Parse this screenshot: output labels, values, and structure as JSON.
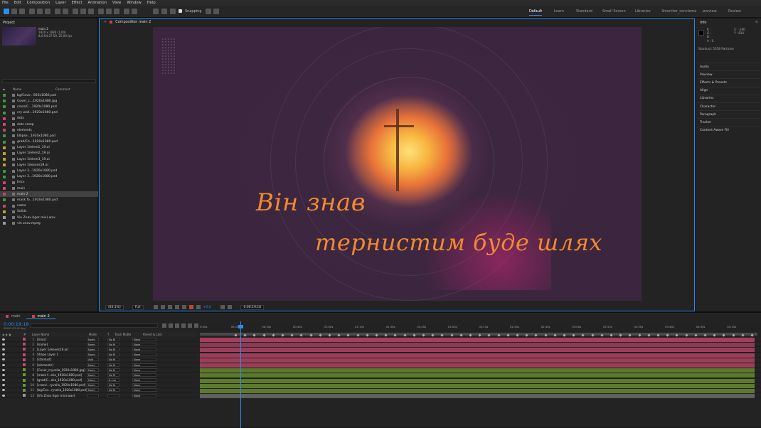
{
  "menu": [
    "File",
    "Edit",
    "Composition",
    "Layer",
    "Effect",
    "Animation",
    "View",
    "Window",
    "Help"
  ],
  "toolbar": {
    "snapping_label": "Snapping"
  },
  "workspaces": [
    {
      "label": "Default",
      "active": true
    },
    {
      "label": "Learn",
      "active": false
    },
    {
      "label": "Standard",
      "active": false
    },
    {
      "label": "Small Screen",
      "active": false
    },
    {
      "label": "Libraries",
      "active": false
    },
    {
      "label": "3monitor_osnclema",
      "active": false
    },
    {
      "label": "preview",
      "active": false
    },
    {
      "label": "Review",
      "active": false
    }
  ],
  "project": {
    "tab": "Project",
    "comp_name": "main 2",
    "comp_res": "1920 x 1080 (1,00)",
    "comp_dur": "Δ 0:04:27:59, 25,00 fps",
    "col_name": "Name",
    "col_comment": "Comment",
    "items": [
      {
        "name": "bg/Cove...920x1080.psd",
        "color": "#3a9a3a",
        "selected": false
      },
      {
        "name": "Cover_c...1920x1080.jpg",
        "color": "#3a9a3a",
        "selected": false
      },
      {
        "name": "cross/C...1920x1080.psd",
        "color": "#3a9a3a",
        "selected": false
      },
      {
        "name": "cry wall...1920x1080.psd",
        "color": "#3a9a3a",
        "selected": false
      },
      {
        "name": "dots",
        "color": "#c04a6a",
        "selected": false
      },
      {
        "name": "dots comp",
        "color": "#c04a6a",
        "selected": false
      },
      {
        "name": "elements",
        "color": "#c04a6a",
        "selected": false
      },
      {
        "name": "Ellipse...1920x1080.psd",
        "color": "#3a9a3a",
        "selected": false
      },
      {
        "name": "grad/Co...1920x1080.psd",
        "color": "#3a9a3a",
        "selected": false
      },
      {
        "name": "Layer 1/elem1_19.ai",
        "color": "#c0a030",
        "selected": false
      },
      {
        "name": "Layer 1/elem2_19.ai",
        "color": "#c0a030",
        "selected": false
      },
      {
        "name": "Layer 1/elem3_19.ai",
        "color": "#c0a030",
        "selected": false
      },
      {
        "name": "Layer 1/waves19.ai",
        "color": "#c0a030",
        "selected": false
      },
      {
        "name": "Layer 3...1920x1080.psd",
        "color": "#3a9a3a",
        "selected": false
      },
      {
        "name": "Layer 3...1920x1080.psd",
        "color": "#3a9a3a",
        "selected": false
      },
      {
        "name": "lirics",
        "color": "#c04a6a",
        "selected": false
      },
      {
        "name": "main",
        "color": "#c04a6a",
        "selected": false
      },
      {
        "name": "main 2",
        "color": "#c04a6a",
        "selected": true
      },
      {
        "name": "mask fo...1920x1080.psd",
        "color": "#3a9a3a",
        "selected": false
      },
      {
        "name": "name",
        "color": "#c04a6a",
        "selected": false
      },
      {
        "name": "Solids",
        "color": "#c0a030",
        "selected": false
      },
      {
        "name": "Vin Znav (Igor mix).wav",
        "color": "#999999",
        "selected": false
      },
      {
        "name": "vin znav.mpeg",
        "color": "#999999",
        "selected": false
      }
    ],
    "footer_bpc": "8 bpc"
  },
  "composition": {
    "tab": "Composition main 2",
    "line1": "Він знав",
    "line2": "тернистим буде шлях",
    "zoom": "(83,1%)",
    "resolution": "Full",
    "color_label": "+0,0",
    "timecode": "0:00:19:18"
  },
  "info": {
    "tab": "Info",
    "r": "R :",
    "g": "G :",
    "b": "B :",
    "a": "A : 0",
    "x": "X : -206",
    "y": "Y : 814",
    "stardust": "Stardust: 5358 Particles"
  },
  "right_sections": [
    "Audio",
    "Preview",
    "Effects & Presets",
    "Align",
    "Libraries",
    "Character",
    "Paragraph",
    "Tracker",
    "Content-Aware Fill"
  ],
  "timeline": {
    "tabs": [
      {
        "label": "main",
        "active": false
      },
      {
        "label": "main 2",
        "active": true
      }
    ],
    "timecode": "0:00:19:18",
    "fps": "00493 (25.00 fps)",
    "hdr_num": "#",
    "hdr_name": "Layer Name",
    "hdr_mode": "Mode",
    "hdr_t": "T",
    "hdr_track": "Track Matte",
    "hdr_parent": "Parent & Link",
    "ruler": [
      "0:00s",
      "00:15s",
      "00:30s",
      "00:45s",
      "01:00s",
      "01:15s",
      "01:30s",
      "01:45s",
      "02:00s",
      "02:15s",
      "02:30s",
      "02:45s",
      "03:00s",
      "03:15s",
      "03:30s",
      "03:45s",
      "04:00s",
      "04:15s"
    ],
    "layers": [
      {
        "num": "1",
        "name": "[lirics]",
        "color": "#c04a6a",
        "mode": "Norm",
        "track": "No M",
        "parent": "None",
        "bar": "#a2405c"
      },
      {
        "num": "2",
        "name": "[name]",
        "color": "#c04a6a",
        "mode": "Norm",
        "track": "No M",
        "parent": "None",
        "bar": "#8e3856"
      },
      {
        "num": "3",
        "name": "[Layer 1/waves19.ai]",
        "color": "#c04a6a",
        "mode": "Norm",
        "track": "No M",
        "parent": "None",
        "bar": "#9c3e5a"
      },
      {
        "num": "4",
        "name": "Shape Layer 1",
        "color": "#c04a6a",
        "mode": "Norm",
        "track": "No M",
        "parent": "None",
        "bar": "#9c3e5a"
      },
      {
        "num": "5",
        "name": "[stardust]",
        "color": "#c04a6a",
        "mode": "Add",
        "track": "No M",
        "parent": "None",
        "bar": "#9c3e5a"
      },
      {
        "num": "6",
        "name": "[elements]",
        "color": "#c04a6a",
        "mode": "Norm",
        "track": "No M",
        "parent": "None",
        "bar": "#9c3e5a"
      },
      {
        "num": "7",
        "name": "[Cover_cryvelia_1920x1080.jpg]",
        "color": "#6a9a2a",
        "mode": "Norm",
        "track": "No M",
        "parent": "None",
        "bar": "#5c7a2c"
      },
      {
        "num": "8",
        "name": "[mask f...elia_1920x1080.psd]",
        "color": "#6a9a2a",
        "mode": "Norm",
        "track": "No M",
        "parent": "None",
        "bar": "#5c7a2c"
      },
      {
        "num": "9",
        "name": "[grad/C...elia_1920x1080.psd]",
        "color": "#6a9a2a",
        "mode": "Norm",
        "track": "IL.ma",
        "parent": "None",
        "bar": "#5c7a2c"
      },
      {
        "num": "10",
        "name": "[cross/...ryvelia_1920x1080.psd]",
        "color": "#6a9a2a",
        "mode": "Norm",
        "track": "No M",
        "parent": "None",
        "bar": "#5c7a2c"
      },
      {
        "num": "11",
        "name": "[bg/Cov...ryvelia_1920x1080.psd]",
        "color": "#6a9a2a",
        "mode": "Norm",
        "track": "No M",
        "parent": "None",
        "bar": "#5c7a2c"
      },
      {
        "num": "12",
        "name": "[Vin Znav (Igor mix).wav]",
        "color": "#999999",
        "mode": "",
        "track": "",
        "parent": "None",
        "bar": "#606060"
      }
    ]
  }
}
